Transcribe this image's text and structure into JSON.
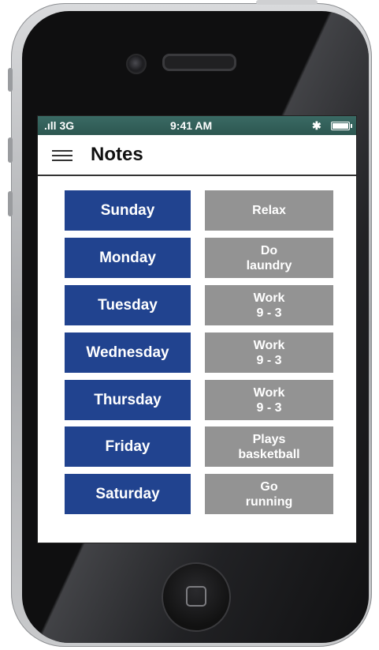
{
  "status_bar": {
    "signal": ".ıll 3G",
    "time": "9:41 AM",
    "bluetooth": "✱"
  },
  "app_bar": {
    "menu_icon": "hamburger-icon",
    "title": "Notes"
  },
  "schedule": [
    {
      "day": "Sunday",
      "note": "Relax"
    },
    {
      "day": "Monday",
      "note": "Do\nlaundry"
    },
    {
      "day": "Tuesday",
      "note": "Work\n9 - 3"
    },
    {
      "day": "Wednesday",
      "note": "Work\n9 - 3"
    },
    {
      "day": "Thursday",
      "note": "Work\n9 - 3"
    },
    {
      "day": "Friday",
      "note": "Plays\nbasketball"
    },
    {
      "day": "Saturday",
      "note": "Go\nrunning"
    }
  ],
  "colors": {
    "day_button": "#21438f",
    "note_button": "#939393",
    "status_bar": "#2f5a54"
  }
}
